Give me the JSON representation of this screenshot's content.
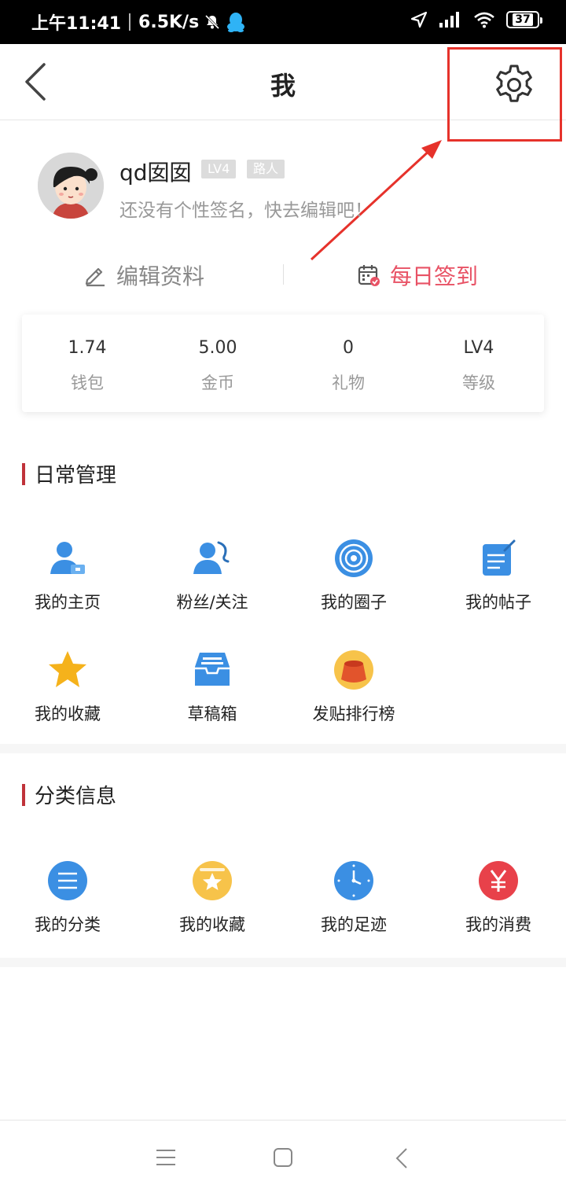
{
  "status_bar": {
    "time": "上午11:41",
    "speed": "6.5K/s",
    "battery": "37"
  },
  "header": {
    "title": "我"
  },
  "profile": {
    "username": "qd囡囡",
    "level_badge": "LV4",
    "role_badge": "路人",
    "signature": "还没有个性签名，快去编辑吧！"
  },
  "actions": {
    "edit_label": "编辑资料",
    "checkin_label": "每日签到"
  },
  "stats": [
    {
      "value": "1.74",
      "label": "钱包"
    },
    {
      "value": "5.00",
      "label": "金币"
    },
    {
      "value": "0",
      "label": "礼物"
    },
    {
      "value": "LV4",
      "label": "等级"
    }
  ],
  "daily": {
    "title": "日常管理",
    "items": [
      {
        "label": "我的主页",
        "icon": "user-home-icon"
      },
      {
        "label": "粉丝/关注",
        "icon": "fans-icon"
      },
      {
        "label": "我的圈子",
        "icon": "circle-icon"
      },
      {
        "label": "我的帖子",
        "icon": "post-icon"
      },
      {
        "label": "我的收藏",
        "icon": "star-icon"
      },
      {
        "label": "草稿箱",
        "icon": "drafts-icon"
      },
      {
        "label": "发贴排行榜",
        "icon": "ranking-icon"
      }
    ]
  },
  "category": {
    "title": "分类信息",
    "items": [
      {
        "label": "我的分类",
        "icon": "list-icon"
      },
      {
        "label": "我的收藏",
        "icon": "favorite-folder-icon"
      },
      {
        "label": "我的足迹",
        "icon": "clock-icon"
      },
      {
        "label": "我的消费",
        "icon": "yen-icon"
      }
    ]
  },
  "colors": {
    "accent": "#e85265",
    "section_bar": "#c0323a",
    "annotation": "#e6322b",
    "icon_blue": "#3b8fe3"
  }
}
